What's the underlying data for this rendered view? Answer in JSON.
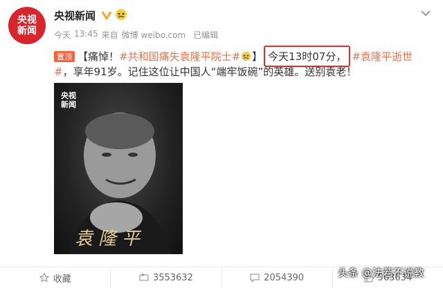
{
  "account": {
    "avatar_text_top": "央视",
    "avatar_text_bottom": "新闻",
    "name": "央视新闻"
  },
  "meta": {
    "date": "今天",
    "time": "13:45",
    "source_prefix": "来自",
    "source": "微博 weibo.com",
    "edited": "已编辑"
  },
  "post": {
    "pin_badge": "置顶",
    "open_bracket": "【痛悼！",
    "hashtag_1": "#共和国痛失袁隆平院士#",
    "close_bracket": "】",
    "highlighted_time": "今天13时07分，",
    "hashtag_2_part_1": "#袁隆平逝世",
    "hashtag_2_part_2": "#",
    "body_rest": "，享年91岁。记住这位让中国人“端牢饭碗”的英雄。送别袁老！"
  },
  "image": {
    "logo_top": "央视",
    "logo_bottom": "新闻",
    "caption": "袁隆平"
  },
  "actions": {
    "favorite_label": "收藏",
    "repost_count": "3553632",
    "comment_count": "2054390",
    "like_count": "563634"
  },
  "watermark": "头条 @法若不说教",
  "colors": {
    "link": "#eb7350",
    "highlight_border": "#e02c2c",
    "avatar_bg": "#d8242b",
    "pin_badge_bg": "#ff5e3a"
  }
}
